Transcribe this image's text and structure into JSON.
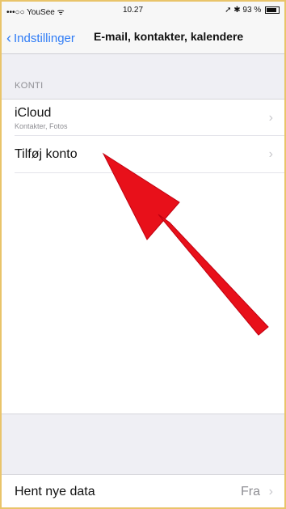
{
  "status_bar": {
    "carrier": "•••○○ YouSee ᯤ",
    "time": "10.27",
    "right": "➚ ✱ 93 %"
  },
  "nav": {
    "back_label": "Indstillinger",
    "title": "E-mail, kontakter, kalendere"
  },
  "accounts": {
    "header": "KONTI",
    "items": [
      {
        "title": "iCloud",
        "subtitle": "Kontakter, Fotos"
      },
      {
        "title": "Tilføj konto"
      }
    ]
  },
  "fetch": {
    "label": "Hent nye data",
    "value": "Fra"
  },
  "colors": {
    "accent": "#2f7cf6",
    "arrow": "#e8101a",
    "frame": "#e9c46a"
  }
}
